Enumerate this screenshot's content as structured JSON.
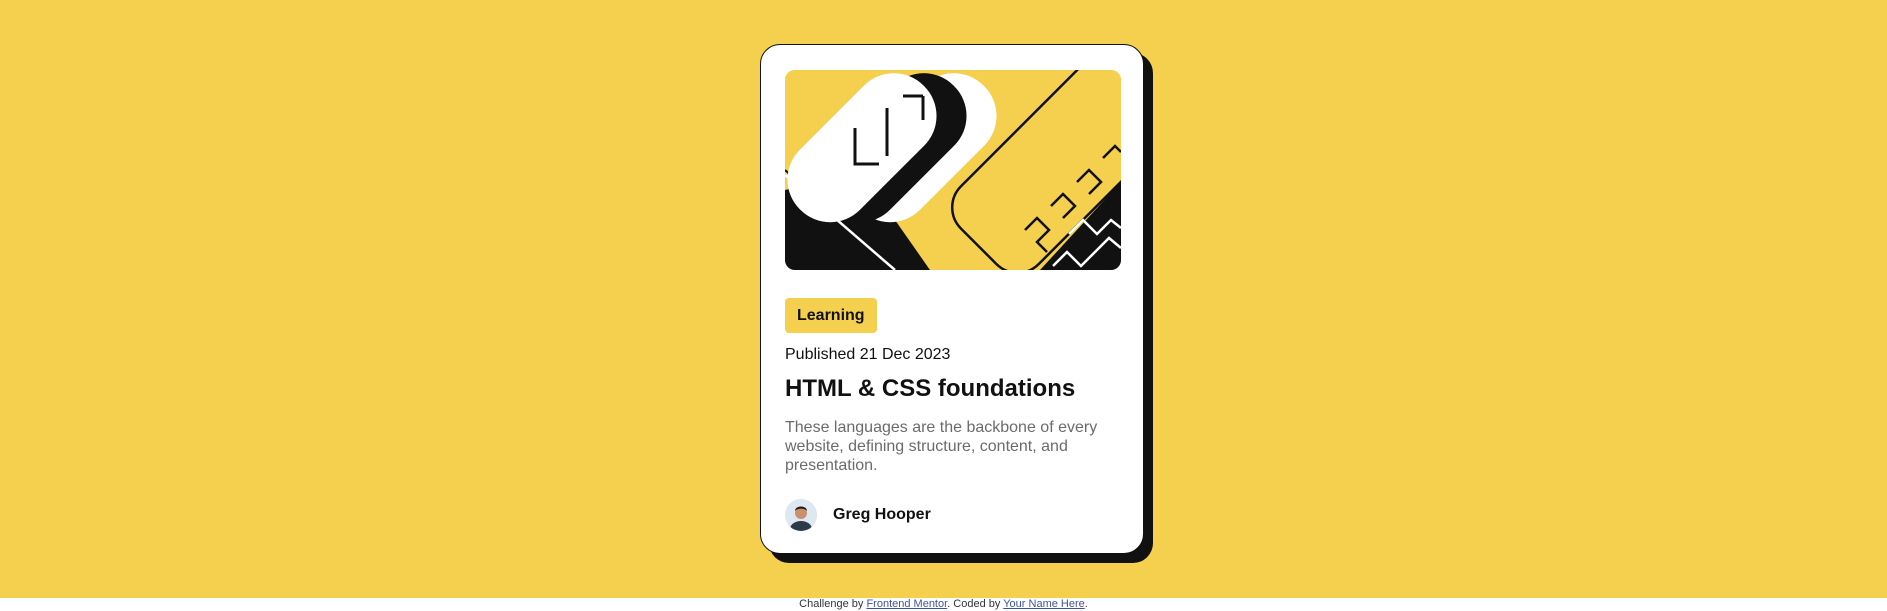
{
  "colors": {
    "background": "#F4D04E",
    "card": "#FFFFFF",
    "ink": "#111111",
    "muted_text": "#6B6B6B",
    "link": "#3E52A3"
  },
  "card": {
    "illustration_icon": "abstract-illustration",
    "tag": "Learning",
    "published": "Published 21 Dec 2023",
    "title": "HTML & CSS foundations",
    "description": "These languages are the backbone of every website, defining structure, content, and presentation.",
    "author": {
      "name": "Greg Hooper",
      "avatar_icon": "avatar-photo"
    }
  },
  "attribution": {
    "prefix": "Challenge by ",
    "link1": "Frontend Mentor",
    "middle": ". Coded by ",
    "link2": "Your Name Here",
    "suffix": "."
  }
}
